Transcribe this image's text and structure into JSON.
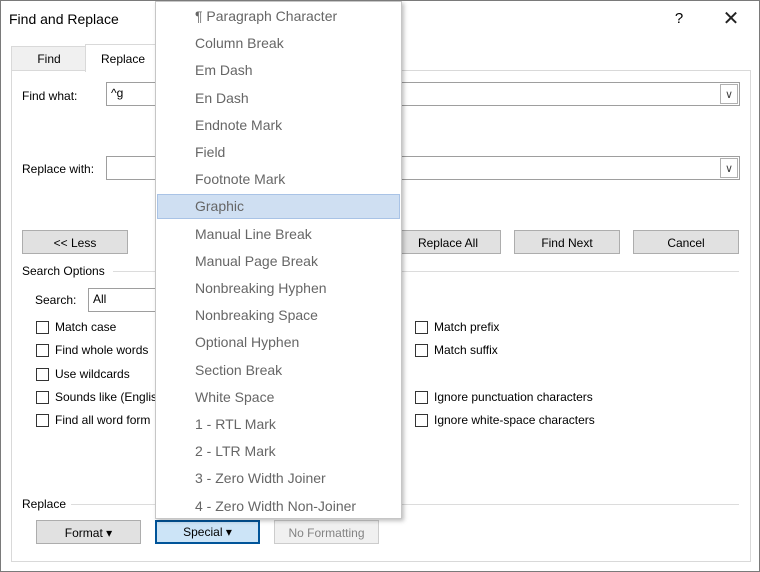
{
  "window": {
    "title": "Find and Replace",
    "help": "?",
    "close": "✕"
  },
  "tabs": [
    {
      "label": "Find",
      "underline": "d"
    },
    {
      "label": "Replace",
      "underline": "p"
    }
  ],
  "find": {
    "label": "Find what:",
    "value": "^g"
  },
  "replace": {
    "label": "Replace with:",
    "value": ""
  },
  "buttons": {
    "less": "<< Less",
    "replace_all": "Replace All",
    "find_next": "Find Next",
    "cancel": "Cancel",
    "format": "Format",
    "special": "Special",
    "no_formatting": "No Formatting"
  },
  "search_options": {
    "heading": "Search Options",
    "search_label": "Search:",
    "search_value": "All"
  },
  "options_left": [
    "Match case",
    "Find whole words",
    "Use wildcards",
    "Sounds like (English",
    "Find all word form"
  ],
  "options_right": [
    "Match prefix",
    "Match suffix",
    "Ignore punctuation characters",
    "Ignore white-space characters"
  ],
  "replace_section": {
    "heading": "Replace"
  },
  "special_menu": {
    "highlighted_index": 7,
    "items": [
      "¶ Paragraph Character",
      "Column Break",
      "Em Dash",
      "En Dash",
      "Endnote Mark",
      "Field",
      "Footnote Mark",
      "Graphic",
      "Manual Line Break",
      "Manual Page Break",
      "Nonbreaking Hyphen",
      "Nonbreaking Space",
      "Optional Hyphen",
      "Section Break",
      "White Space",
      "1 - RTL Mark",
      "2 - LTR Mark",
      "3 - Zero Width Joiner",
      "4 - Zero Width Non-Joiner"
    ]
  }
}
